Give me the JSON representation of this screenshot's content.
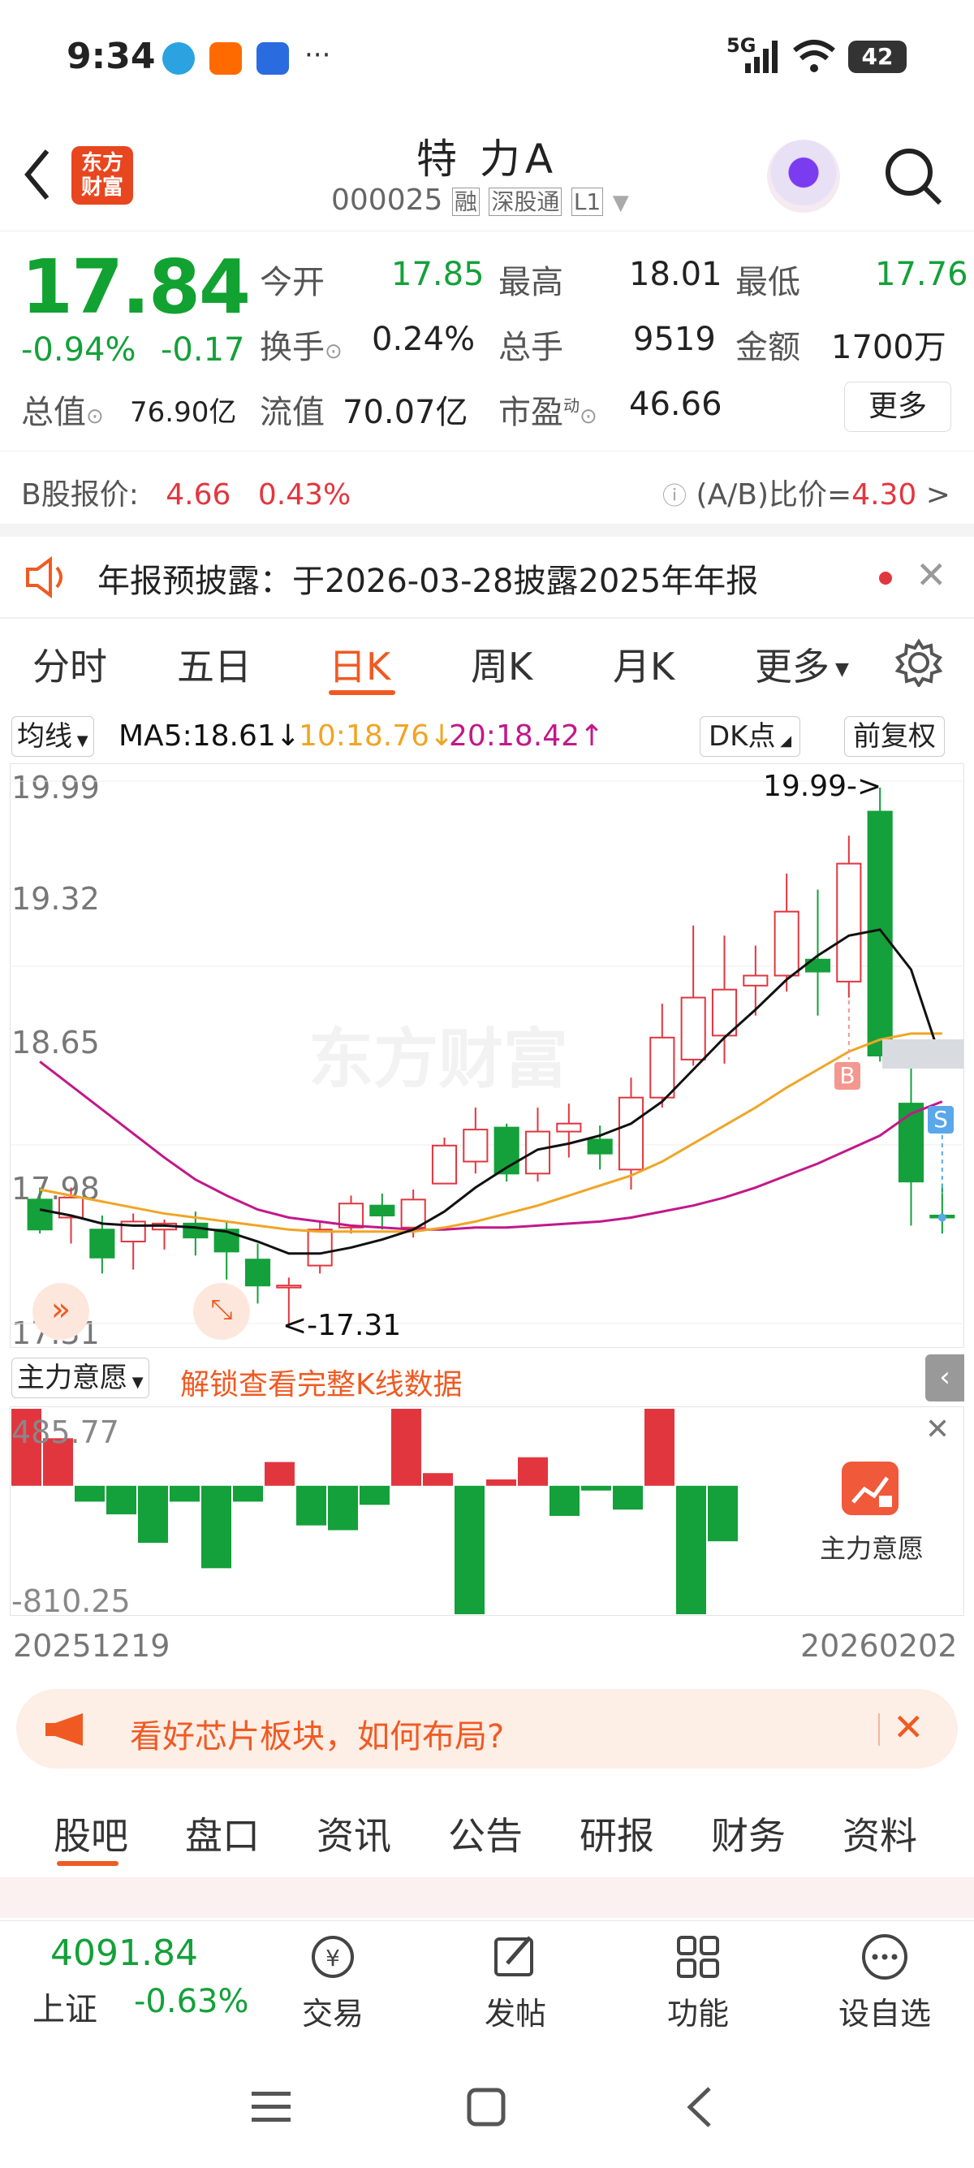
{
  "status": {
    "time": "9:34",
    "signal": "5G",
    "battery": "42",
    "more": "···"
  },
  "header": {
    "logo_line1": "东方",
    "logo_line2": "财富",
    "stock_name": "特 力A",
    "stock_code": "000025",
    "tag_rong": "融",
    "tag_sgt": "深股通",
    "tag_l1": "L1"
  },
  "quote": {
    "price": "17.84",
    "change_pct": "-0.94%",
    "change_abs": "-0.17",
    "open_label": "今开",
    "open": "17.85",
    "high_label": "最高",
    "high": "18.01",
    "low_label": "最低",
    "low": "17.76",
    "turnover_label": "换手",
    "turnover": "0.24%",
    "volume_label": "总手",
    "volume": "9519",
    "amount_label": "金额",
    "amount": "1700万",
    "mktcap_label": "总值",
    "mktcap": "76.90亿",
    "float_label": "流值",
    "float": "70.07亿",
    "pe_label": "市盈",
    "pe_sup": "动",
    "pe": "46.66",
    "more": "更多"
  },
  "bshare": {
    "label": "B股报价:",
    "price": "4.66",
    "pct": "0.43%",
    "ratio_label": "(A/B)比价=",
    "ratio": "4.30"
  },
  "notice": {
    "text": "年报预披露：于2026-03-28披露2025年年报"
  },
  "tabs": [
    "分时",
    "五日",
    "日K",
    "周K",
    "月K",
    "更多"
  ],
  "active_tab": 2,
  "ma": {
    "selector": "均线",
    "ma5": "MA5:18.61",
    "ma10": "10:18.76",
    "ma20": "20:18.42",
    "dk": "DK点",
    "adj": "前复权"
  },
  "colors": {
    "up": "#e2363f",
    "down": "#14a03a",
    "ma5": "#111111",
    "ma10": "#f0a526",
    "ma20": "#c2188a",
    "accent": "#f05a22"
  },
  "chart_data": [
    {
      "type": "candlestick",
      "yticks": [
        "19.99",
        "19.32",
        "18.65",
        "17.98",
        "17.31"
      ],
      "ylim": [
        17.31,
        19.99
      ],
      "max_label": "19.99->",
      "min_label": "<-17.31",
      "start_date": "20251219",
      "end_date": "20260202",
      "candles": [
        [
          17.93,
          17.78,
          17.99,
          17.76
        ],
        [
          17.84,
          17.94,
          17.99,
          17.71
        ],
        [
          17.78,
          17.64,
          17.85,
          17.56
        ],
        [
          17.72,
          17.82,
          17.86,
          17.58
        ],
        [
          17.78,
          17.81,
          17.83,
          17.68
        ],
        [
          17.81,
          17.74,
          17.87,
          17.65
        ],
        [
          17.78,
          17.67,
          17.82,
          17.53
        ],
        [
          17.63,
          17.5,
          17.71,
          17.41
        ],
        [
          17.49,
          17.5,
          17.54,
          17.31
        ],
        [
          17.6,
          17.78,
          17.82,
          17.56
        ],
        [
          17.79,
          17.91,
          17.95,
          17.76
        ],
        [
          17.9,
          17.85,
          17.96,
          17.78
        ],
        [
          17.79,
          17.93,
          17.98,
          17.74
        ],
        [
          18.01,
          18.2,
          18.24,
          18.02
        ],
        [
          18.12,
          18.28,
          18.39,
          18.06
        ],
        [
          18.29,
          18.06,
          18.31,
          18.02
        ],
        [
          18.06,
          18.27,
          18.39,
          18.02
        ],
        [
          18.27,
          18.31,
          18.41,
          18.14
        ],
        [
          18.23,
          18.16,
          18.3,
          18.08
        ],
        [
          18.08,
          18.44,
          18.54,
          17.98
        ],
        [
          18.44,
          18.74,
          18.91,
          18.39
        ],
        [
          18.63,
          18.94,
          19.3,
          18.6
        ],
        [
          18.75,
          18.98,
          19.25,
          18.61
        ],
        [
          19.0,
          19.05,
          19.2,
          18.85
        ],
        [
          19.05,
          19.37,
          19.56,
          18.97
        ],
        [
          19.13,
          19.07,
          19.48,
          18.85
        ],
        [
          19.02,
          19.61,
          19.75,
          18.94
        ],
        [
          19.87,
          18.65,
          19.99,
          18.62
        ],
        [
          18.41,
          18.02,
          18.6,
          17.8
        ],
        [
          17.85,
          17.84,
          18.01,
          17.76
        ]
      ],
      "ma5": [
        17.88,
        17.85,
        17.81,
        17.8,
        17.8,
        17.79,
        17.77,
        17.72,
        17.66,
        17.66,
        17.69,
        17.73,
        17.78,
        17.87,
        17.99,
        18.09,
        18.18,
        18.21,
        18.25,
        18.31,
        18.42,
        18.58,
        18.74,
        18.88,
        19.03,
        19.15,
        19.25,
        19.28,
        19.08,
        18.61
      ],
      "ma10": [
        17.98,
        17.95,
        17.92,
        17.89,
        17.86,
        17.84,
        17.82,
        17.8,
        17.78,
        17.77,
        17.77,
        17.77,
        17.77,
        17.79,
        17.82,
        17.86,
        17.9,
        17.95,
        18.0,
        18.05,
        18.12,
        18.21,
        18.3,
        18.39,
        18.49,
        18.58,
        18.67,
        18.73,
        18.76,
        18.76
      ],
      "ma20": [
        18.62,
        18.5,
        18.38,
        18.26,
        18.14,
        18.03,
        17.95,
        17.88,
        17.84,
        17.82,
        17.8,
        17.79,
        17.78,
        17.78,
        17.79,
        17.79,
        17.8,
        17.81,
        17.82,
        17.84,
        17.87,
        17.9,
        17.94,
        17.99,
        18.05,
        18.11,
        18.18,
        18.25,
        18.36,
        18.42
      ],
      "b_marker": "B",
      "s_marker": "S"
    },
    {
      "type": "bar",
      "title": "主力意愿",
      "yticks": [
        "485.77",
        "-810.25"
      ],
      "ylim": [
        -810.25,
        485.77
      ],
      "values": [
        485.77,
        300,
        -100,
        -180,
        -360,
        -100,
        -520,
        -100,
        150,
        -250,
        -280,
        -120,
        485.77,
        80,
        -810.25,
        40,
        180,
        -190,
        -30,
        -150,
        485.77,
        -810.25,
        -350
      ]
    }
  ],
  "indicator": {
    "selector": "主力意愿",
    "unlock": "解锁查看完整K线数据",
    "panel_label": "主力意愿"
  },
  "ad": {
    "text": "看好芯片板块，如何布局?"
  },
  "section_tabs": [
    "股吧",
    "盘口",
    "资讯",
    "公告",
    "研报",
    "财务",
    "资料"
  ],
  "bottom": {
    "index_value": "4091.84",
    "index_name": "上证",
    "index_pct": "-0.63%",
    "nav": [
      "交易",
      "发帖",
      "功能",
      "设自选"
    ]
  }
}
